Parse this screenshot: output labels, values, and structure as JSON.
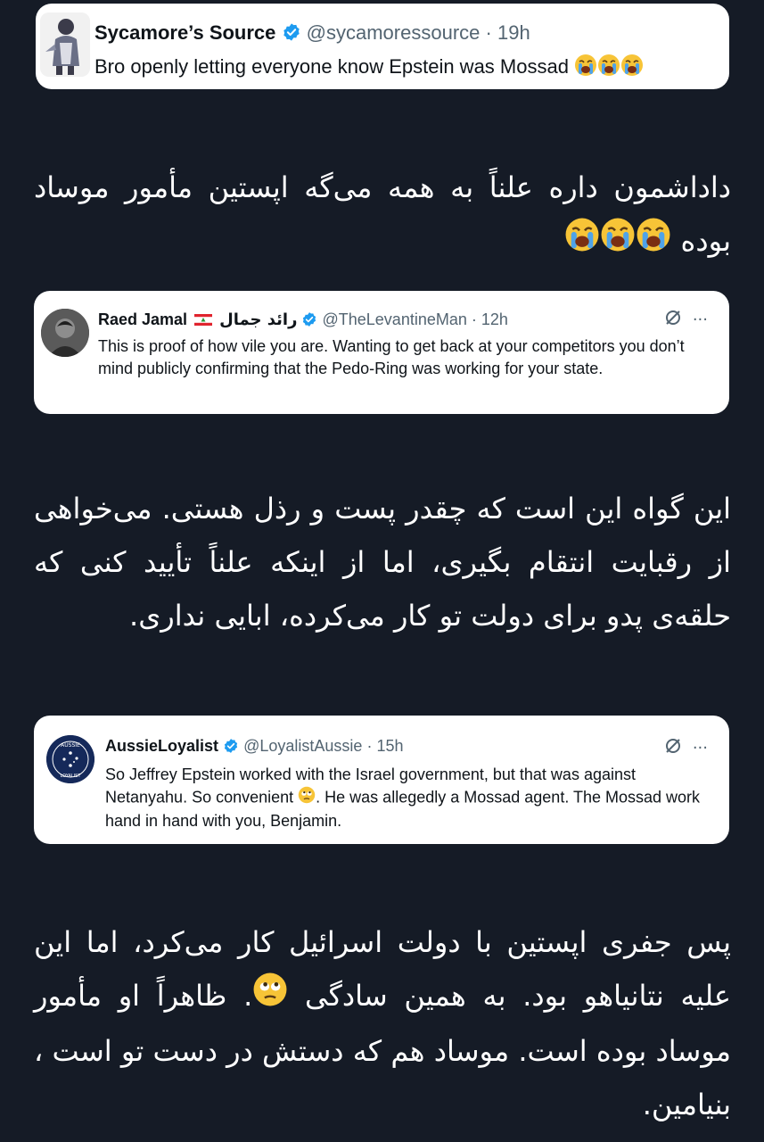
{
  "tweet1": {
    "display_name": "Sycamore’s Source",
    "handle": "@sycamoressource",
    "separator": "·",
    "time": "19h",
    "text": "Bro openly letting everyone know Epstein was Mossad",
    "emojis": [
      "loudly-crying-face-icon",
      "loudly-crying-face-icon",
      "loudly-crying-face-icon"
    ]
  },
  "translation1": {
    "text": "داداشمون داره علناً به همه می‌گه اپستین مأمور موساد بوده"
  },
  "tweet2": {
    "display_name": "Raed Jamal",
    "display_name_arabic": "رائد جمال",
    "handle": "@TheLevantineMan",
    "separator": "·",
    "time": "12h",
    "text": "This is proof of how vile you are. Wanting to get back at your competitors you don’t mind publicly confirming that the Pedo-Ring was working for your state.",
    "more_label": "···"
  },
  "translation2": {
    "text": "این گواه این است که چقدر پست و رذل هستی. می‌خواهی از رقبایت انتقام بگیری، اما از اینکه علناً تأیید کنی که حلقه‌ی پدو برای دولت تو کار می‌کرده، ابایی نداری."
  },
  "tweet3": {
    "display_name": "AussieLoyalist",
    "handle": "@LoyalistAussie",
    "separator": "·",
    "time": "15h",
    "avatar_text_top": "AUSSIE",
    "avatar_text_bottom": "LOYALIST",
    "text_before_emoji": "So Jeffrey Epstein worked with the Israel government, but that was against Netanyahu. So convenient ",
    "text_after_emoji": ". He was allegedly a Mossad agent. The Mossad work hand in hand with you, Benjamin.",
    "more_label": "···"
  },
  "translation3": {
    "text_before_emoji": "پس جفری اپستین با دولت اسرائیل کار می‌کرد، اما این علیه نتانیاهو بود. به همین سادگی ",
    "text_after_emoji": ". ظاهراً او مأمور موساد بوده است. موساد هم که دستش در دست تو است ، بنیامین."
  },
  "colors": {
    "background": "#151b26",
    "card": "#ffffff",
    "verified_blue": "#1d9bf0",
    "meta_gray": "#536471"
  }
}
